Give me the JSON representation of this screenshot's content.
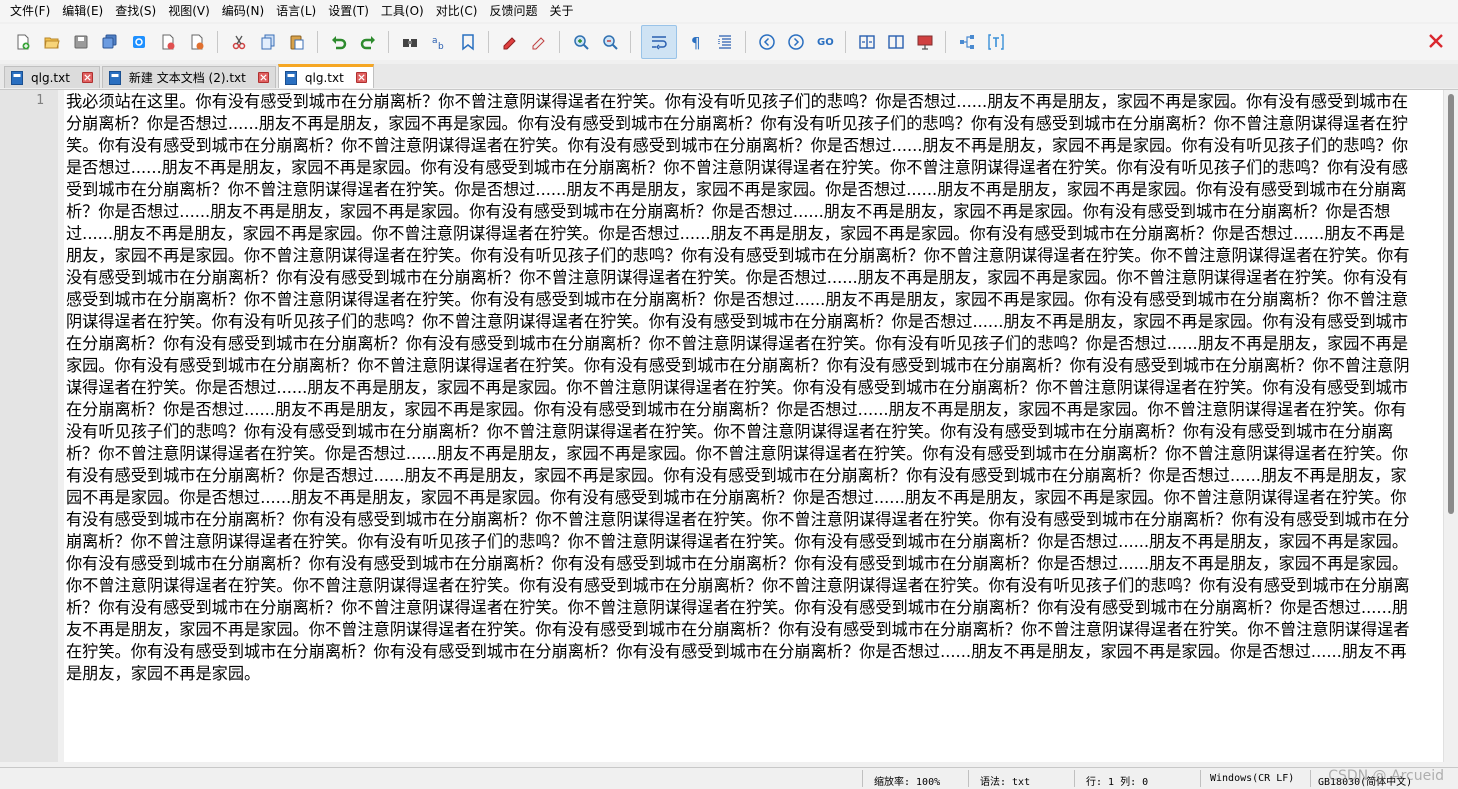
{
  "menu": {
    "items": [
      "文件(F)",
      "编辑(E)",
      "查找(S)",
      "视图(V)",
      "编码(N)",
      "语言(L)",
      "设置(T)",
      "工具(O)",
      "对比(C)",
      "反馈问题",
      "关于"
    ]
  },
  "toolbar": {
    "buttons": [
      "new-file-icon",
      "open-file-icon",
      "save-icon",
      "save-all-icon",
      "reload-icon",
      "print-icon",
      "close-all-icon",
      "cut-icon",
      "copy-icon",
      "paste-icon",
      "undo-icon",
      "redo-icon",
      "find-icon",
      "replace-icon",
      "bookmark-icon",
      "highlight-icon",
      "clear-highlight-icon",
      "zoom-in-icon",
      "zoom-out-icon",
      "word-wrap-icon",
      "show-all-chars-icon",
      "indent-guide-icon",
      "prev-icon",
      "next-icon",
      "goto-icon",
      "split-horizontal-icon",
      "split-vertical-icon",
      "present-icon",
      "structure-icon",
      "text-format-icon"
    ],
    "active_button": "word-wrap-icon",
    "close_icon": "close-icon"
  },
  "tabs": [
    {
      "label": "qlg.txt",
      "active": false
    },
    {
      "label": "新建 文本文档 (2).txt",
      "active": false
    },
    {
      "label": "qlg.txt",
      "active": true
    }
  ],
  "editor": {
    "line_number": "1",
    "content": "我必须站在这里。你有没有感受到城市在分崩离析？你不曾注意阴谋得逞者在狞笑。你有没有听见孩子们的悲鸣？你是否想过......朋友不再是朋友，家园不再是家园。你有没有感受到城市在分崩离析？你是否想过......朋友不再是朋友，家园不再是家园。你有没有感受到城市在分崩离析？你有没有听见孩子们的悲鸣？你有没有感受到城市在分崩离析？你不曾注意阴谋得逞者在狞笑。你有没有感受到城市在分崩离析？你不曾注意阴谋得逞者在狞笑。你有没有感受到城市在分崩离析？你是否想过......朋友不再是朋友，家园不再是家园。你有没有听见孩子们的悲鸣？你是否想过......朋友不再是朋友，家园不再是家园。你有没有感受到城市在分崩离析？你不曾注意阴谋得逞者在狞笑。你不曾注意阴谋得逞者在狞笑。你有没有听见孩子们的悲鸣？你有没有感受到城市在分崩离析？你不曾注意阴谋得逞者在狞笑。你是否想过......朋友不再是朋友，家园不再是家园。你是否想过......朋友不再是朋友，家园不再是家园。你有没有感受到城市在分崩离析？你是否想过......朋友不再是朋友，家园不再是家园。你有没有感受到城市在分崩离析？你是否想过......朋友不再是朋友，家园不再是家园。你有没有感受到城市在分崩离析？你是否想过......朋友不再是朋友，家园不再是家园。你不曾注意阴谋得逞者在狞笑。你是否想过......朋友不再是朋友，家园不再是家园。你有没有感受到城市在分崩离析？你是否想过......朋友不再是朋友，家园不再是家园。你不曾注意阴谋得逞者在狞笑。你有没有听见孩子们的悲鸣？你有没有感受到城市在分崩离析？你不曾注意阴谋得逞者在狞笑。你不曾注意阴谋得逞者在狞笑。你有没有感受到城市在分崩离析？你有没有感受到城市在分崩离析？你不曾注意阴谋得逞者在狞笑。你是否想过......朋友不再是朋友，家园不再是家园。你不曾注意阴谋得逞者在狞笑。你有没有感受到城市在分崩离析？你不曾注意阴谋得逞者在狞笑。你有没有感受到城市在分崩离析？你是否想过......朋友不再是朋友，家园不再是家园。你有没有感受到城市在分崩离析？你不曾注意阴谋得逞者在狞笑。你有没有听见孩子们的悲鸣？你不曾注意阴谋得逞者在狞笑。你有没有感受到城市在分崩离析？你是否想过......朋友不再是朋友，家园不再是家园。你有没有感受到城市在分崩离析？你有没有感受到城市在分崩离析？你有没有感受到城市在分崩离析？你不曾注意阴谋得逞者在狞笑。你有没有听见孩子们的悲鸣？你是否想过......朋友不再是朋友，家园不再是家园。你有没有感受到城市在分崩离析？你不曾注意阴谋得逞者在狞笑。你有没有感受到城市在分崩离析？你有没有感受到城市在分崩离析？你有没有感受到城市在分崩离析？你不曾注意阴谋得逞者在狞笑。你是否想过......朋友不再是朋友，家园不再是家园。你不曾注意阴谋得逞者在狞笑。你有没有感受到城市在分崩离析？你不曾注意阴谋得逞者在狞笑。你有没有感受到城市在分崩离析？你是否想过......朋友不再是朋友，家园不再是家园。你有没有感受到城市在分崩离析？你是否想过......朋友不再是朋友，家园不再是家园。你不曾注意阴谋得逞者在狞笑。你有没有听见孩子们的悲鸣？你有没有感受到城市在分崩离析？你不曾注意阴谋得逞者在狞笑。你不曾注意阴谋得逞者在狞笑。你有没有感受到城市在分崩离析？你有没有感受到城市在分崩离析？你不曾注意阴谋得逞者在狞笑。你是否想过......朋友不再是朋友，家园不再是家园。你不曾注意阴谋得逞者在狞笑。你有没有感受到城市在分崩离析？你不曾注意阴谋得逞者在狞笑。你有没有感受到城市在分崩离析？你是否想过......朋友不再是朋友，家园不再是家园。你有没有感受到城市在分崩离析？你有没有感受到城市在分崩离析？你是否想过......朋友不再是朋友，家园不再是家园。你是否想过......朋友不再是朋友，家园不再是家园。你有没有感受到城市在分崩离析？你是否想过......朋友不再是朋友，家园不再是家园。你不曾注意阴谋得逞者在狞笑。你有没有感受到城市在分崩离析？你有没有感受到城市在分崩离析？你不曾注意阴谋得逞者在狞笑。你不曾注意阴谋得逞者在狞笑。你有没有感受到城市在分崩离析？你有没有感受到城市在分崩离析？你不曾注意阴谋得逞者在狞笑。你有没有听见孩子们的悲鸣？你不曾注意阴谋得逞者在狞笑。你有没有感受到城市在分崩离析？你是否想过......朋友不再是朋友，家园不再是家园。你有没有感受到城市在分崩离析？你有没有感受到城市在分崩离析？你有没有感受到城市在分崩离析？你有没有感受到城市在分崩离析？你是否想过......朋友不再是朋友，家园不再是家园。你不曾注意阴谋得逞者在狞笑。你不曾注意阴谋得逞者在狞笑。你有没有感受到城市在分崩离析？你不曾注意阴谋得逞者在狞笑。你有没有听见孩子们的悲鸣？你有没有感受到城市在分崩离析？你有没有感受到城市在分崩离析？你不曾注意阴谋得逞者在狞笑。你不曾注意阴谋得逞者在狞笑。你有没有感受到城市在分崩离析？你有没有感受到城市在分崩离析？你是否想过......朋友不再是朋友，家园不再是家园。你不曾注意阴谋得逞者在狞笑。你有没有感受到城市在分崩离析？你有没有感受到城市在分崩离析？你不曾注意阴谋得逞者在狞笑。你不曾注意阴谋得逞者在狞笑。你有没有感受到城市在分崩离析？你有没有感受到城市在分崩离析？你有没有感受到城市在分崩离析？你是否想过......朋友不再是朋友，家园不再是家园。你是否想过......朋友不再是朋友，家园不再是家园。"
  },
  "status": {
    "zoom": "缩放率: 100%",
    "language": "语法: txt",
    "position": "行: 1 列: 0",
    "eol": "Windows(CR LF)",
    "encoding": "GB18030(简体中文)",
    "watermark": "CSDN @ Arcueid"
  },
  "colors": {
    "active_tab_accent": "#f5a623",
    "close_icon": "#d9272e",
    "active_button_bg": "#cfe3f4"
  }
}
